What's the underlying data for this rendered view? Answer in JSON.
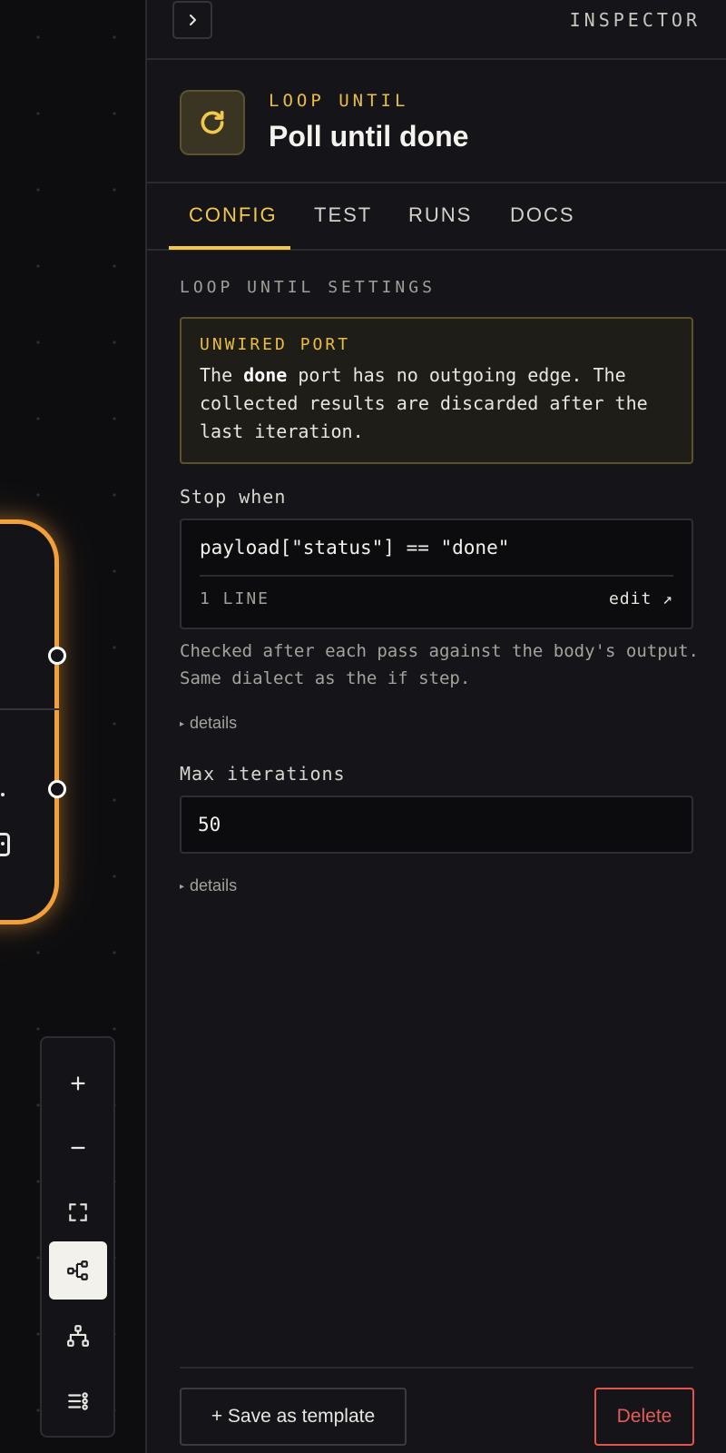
{
  "inspector": {
    "label": "INSPECTOR",
    "collapse_icon": "chevron-right-icon"
  },
  "node": {
    "kind": "LOOP UNTIL",
    "title": "Poll until done",
    "icon": "refresh-icon",
    "accent": "#f0c84a"
  },
  "tabs": [
    {
      "label": "CONFIG",
      "active": true
    },
    {
      "label": "TEST",
      "active": false
    },
    {
      "label": "RUNS",
      "active": false
    },
    {
      "label": "DOCS",
      "active": false
    }
  ],
  "settings": {
    "section_title": "LOOP UNTIL SETTINGS",
    "warning": {
      "title": "UNWIRED PORT",
      "text_before": "The ",
      "port_name": "done",
      "text_after": " port has no outgoing edge. The collected results are discarded after the last iteration."
    },
    "stop_when": {
      "label": "Stop when",
      "expression": "payload[\"status\"] == \"done\"",
      "line_count": "1 LINE",
      "edit_label": "edit ↗",
      "help": "Checked after each pass against the body's output. Same dialect as the if step.",
      "details_label": "details"
    },
    "max_iterations": {
      "label": "Max iterations",
      "value": "50",
      "details_label": "details"
    }
  },
  "footer": {
    "save_template_label": "+ Save as template",
    "delete_label": "Delete"
  },
  "canvas_controls": [
    {
      "name": "zoom-in",
      "icon": "plus-icon"
    },
    {
      "name": "zoom-out",
      "icon": "minus-icon"
    },
    {
      "name": "fit-view",
      "icon": "fit-view-icon"
    },
    {
      "name": "horizontal-layout",
      "icon": "flow-horizontal-icon",
      "active": true
    },
    {
      "name": "tree-layout",
      "icon": "tree-icon"
    },
    {
      "name": "list-layout",
      "icon": "list-icon"
    }
  ],
  "colors": {
    "node_border": "#f2a03b",
    "danger": "#e35d56",
    "background": "#151519"
  }
}
